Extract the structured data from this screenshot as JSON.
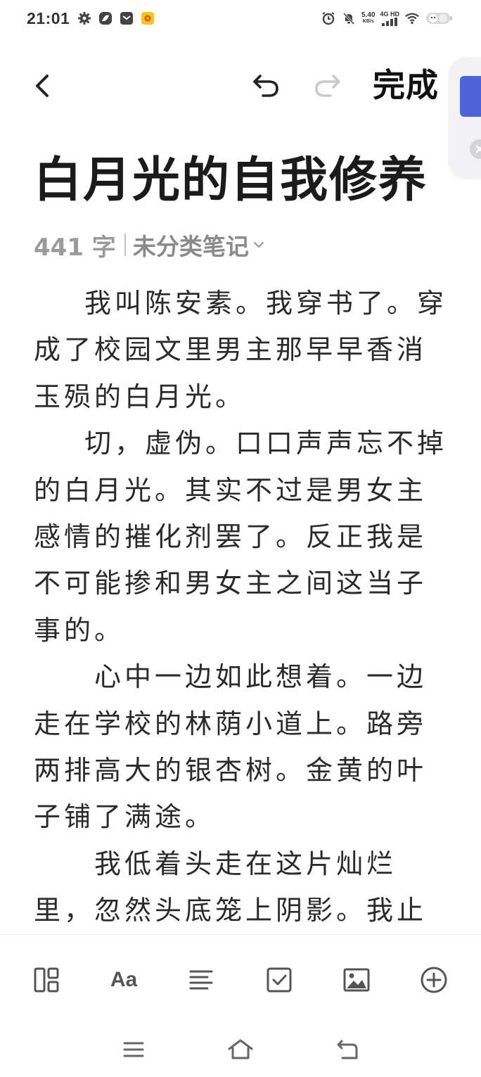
{
  "status_bar": {
    "time": "21:01",
    "net_speed_value": "5.40",
    "net_speed_unit": "KB/s",
    "signal_label": "4G HD"
  },
  "toolbar": {
    "done_label": "完成"
  },
  "note": {
    "title": "白月光的自我修养",
    "word_count": "441 字",
    "category": "未分类笔记",
    "paragraphs": [
      "我叫陈安素。我穿书了。穿成了校园文里男主那早早香消玉殒的白月光。",
      "切，虚伪。口口声声忘不掉的白月光。其实不过是男女主感情的摧化剂罢了。反正我是不可能掺和男女主之间这当子事的。",
      "心中一边如此想着。一边走在学校的林荫小道上。路旁两排高大的银杏树。金黄的叶子铺了满途。",
      "我低着头走在这片灿烂里，忽然头底笼上阴影。我止"
    ]
  },
  "editor_toolbar": {
    "font_label": "Aa",
    "icons": [
      "layout-icon",
      "font-icon",
      "align-icon",
      "checkbox-icon",
      "image-icon",
      "add-circle-icon"
    ]
  },
  "nav_bar": {
    "icons": [
      "menu-icon",
      "home-icon",
      "back-nav-icon"
    ]
  },
  "colors": {
    "accent": "#4e63d6",
    "title": "#1b1b1b",
    "meta": "#9a9a9a",
    "body_text": "#2a2a2a"
  }
}
